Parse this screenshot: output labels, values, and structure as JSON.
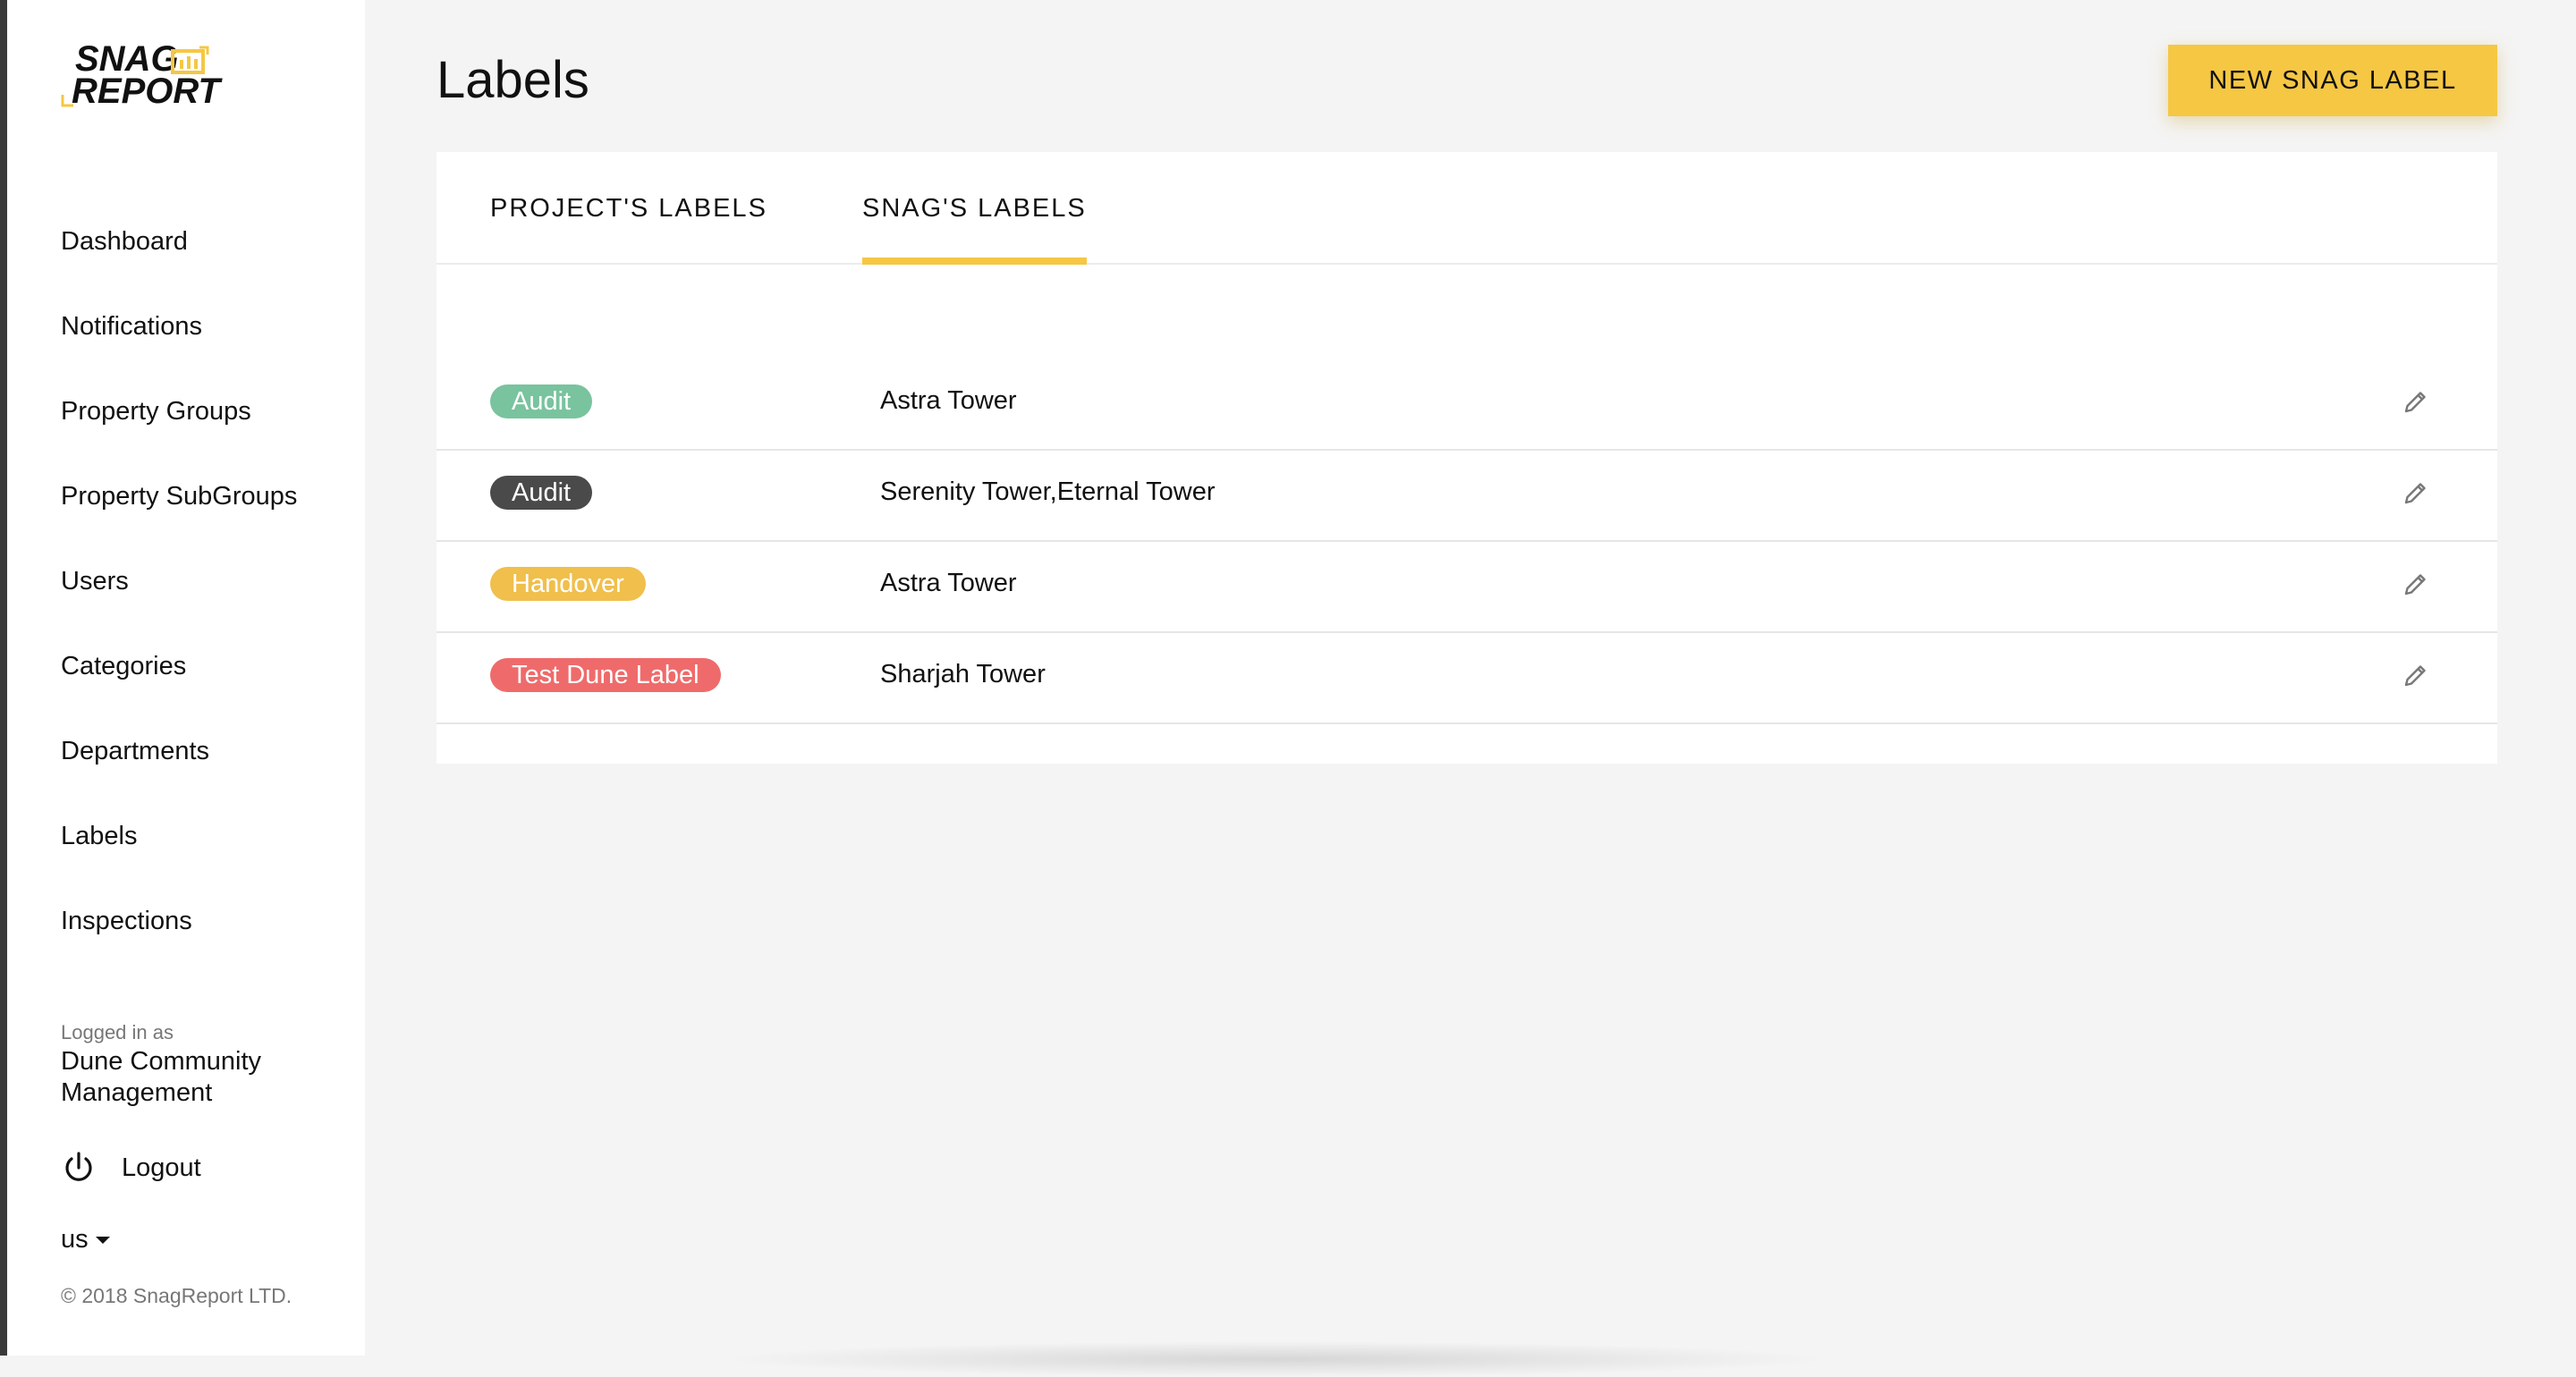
{
  "brand": {
    "logo_line1": "SNAG",
    "logo_line2": "REPORT",
    "accent_color": "#f5c743",
    "logo_icon": "report-chart-icon"
  },
  "sidebar": {
    "items": [
      {
        "label": "Dashboard"
      },
      {
        "label": "Notifications"
      },
      {
        "label": "Property Groups"
      },
      {
        "label": "Property SubGroups"
      },
      {
        "label": "Users"
      },
      {
        "label": "Categories"
      },
      {
        "label": "Departments"
      },
      {
        "label": "Labels"
      },
      {
        "label": "Inspections"
      }
    ],
    "logged_in_label": "Logged in as",
    "user_name": "Dune Community Management",
    "logout_label": "Logout",
    "logout_icon": "power-icon",
    "language": "us",
    "copyright": "© 2018 SnagReport LTD."
  },
  "main": {
    "title": "Labels",
    "new_button_label": "NEW SNAG LABEL",
    "tabs": [
      {
        "label": "PROJECT'S LABELS",
        "active": false
      },
      {
        "label": "SNAG'S LABELS",
        "active": true
      }
    ],
    "rows": [
      {
        "label": "Audit",
        "color": "#79c39f",
        "projects": "Astra Tower"
      },
      {
        "label": "Audit",
        "color": "#4a4a4a",
        "projects": "Serenity Tower,Eternal Tower"
      },
      {
        "label": "Handover",
        "color": "#f0bf4c",
        "projects": "Astra Tower"
      },
      {
        "label": "Test Dune Label",
        "color": "#ef6b6b",
        "projects": "Sharjah Tower"
      }
    ],
    "edit_icon": "pencil-icon"
  }
}
